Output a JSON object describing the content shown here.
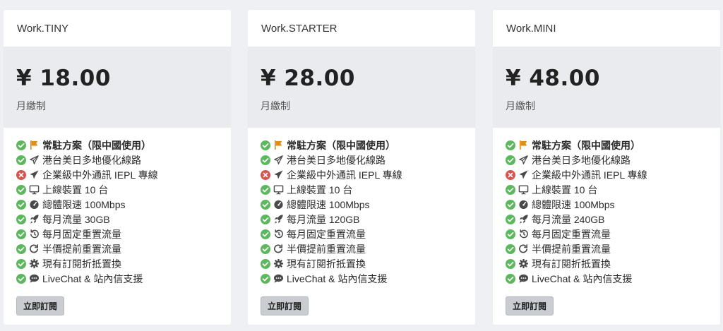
{
  "colors": {
    "check": "#5cb85c",
    "cross": "#d9534f",
    "highlight": "#e48c15",
    "icon": "#4a4a4a"
  },
  "plans": [
    {
      "name": "Work.TINY",
      "price": "¥ 18.00",
      "period": "月繳制",
      "features": [
        {
          "status": "check",
          "icon": "flag-icon",
          "text": "常駐方案（限中國使用）",
          "highlight": true
        },
        {
          "status": "check",
          "icon": "paper-plane-outline-icon",
          "text": "港台美日多地優化線路"
        },
        {
          "status": "cross",
          "icon": "paper-plane-icon",
          "text": "企業級中外通訊 IEPL 專線"
        },
        {
          "status": "check",
          "icon": "monitor-icon",
          "text": "上線裝置 10 台"
        },
        {
          "status": "check",
          "icon": "speedometer-icon",
          "text": "總體限速 100Mbps"
        },
        {
          "status": "check",
          "icon": "rocket-icon",
          "text": "每月流量 30GB"
        },
        {
          "status": "check",
          "icon": "history-icon",
          "text": "每月固定重置流量"
        },
        {
          "status": "check",
          "icon": "redo-icon",
          "text": "半價提前重置流量"
        },
        {
          "status": "check",
          "icon": "gear-icon",
          "text": "現有訂閱折抵置換"
        },
        {
          "status": "check",
          "icon": "chat-bubble-icon",
          "text": "LiveChat & 站內信支援"
        }
      ],
      "button": "立即訂閱"
    },
    {
      "name": "Work.STARTER",
      "price": "¥ 28.00",
      "period": "月繳制",
      "features": [
        {
          "status": "check",
          "icon": "flag-icon",
          "text": "常駐方案（限中國使用）",
          "highlight": true
        },
        {
          "status": "check",
          "icon": "paper-plane-outline-icon",
          "text": "港台美日多地優化線路"
        },
        {
          "status": "cross",
          "icon": "paper-plane-icon",
          "text": "企業級中外通訊 IEPL 專線"
        },
        {
          "status": "check",
          "icon": "monitor-icon",
          "text": "上線裝置 10 台"
        },
        {
          "status": "check",
          "icon": "speedometer-icon",
          "text": "總體限速 100Mbps"
        },
        {
          "status": "check",
          "icon": "rocket-icon",
          "text": "每月流量 120GB"
        },
        {
          "status": "check",
          "icon": "history-icon",
          "text": "每月固定重置流量"
        },
        {
          "status": "check",
          "icon": "redo-icon",
          "text": "半價提前重置流量"
        },
        {
          "status": "check",
          "icon": "gear-icon",
          "text": "現有訂閱折抵置換"
        },
        {
          "status": "check",
          "icon": "chat-bubble-icon",
          "text": "LiveChat & 站內信支援"
        }
      ],
      "button": "立即訂閱"
    },
    {
      "name": "Work.MINI",
      "price": "¥ 48.00",
      "period": "月繳制",
      "features": [
        {
          "status": "check",
          "icon": "flag-icon",
          "text": "常駐方案（限中國使用）",
          "highlight": true
        },
        {
          "status": "check",
          "icon": "paper-plane-outline-icon",
          "text": "港台美日多地優化線路"
        },
        {
          "status": "cross",
          "icon": "paper-plane-icon",
          "text": "企業級中外通訊 IEPL 專線"
        },
        {
          "status": "check",
          "icon": "monitor-icon",
          "text": "上線裝置 10 台"
        },
        {
          "status": "check",
          "icon": "speedometer-icon",
          "text": "總體限速 100Mbps"
        },
        {
          "status": "check",
          "icon": "rocket-icon",
          "text": "每月流量 240GB"
        },
        {
          "status": "check",
          "icon": "history-icon",
          "text": "每月固定重置流量"
        },
        {
          "status": "check",
          "icon": "redo-icon",
          "text": "半價提前重置流量"
        },
        {
          "status": "check",
          "icon": "gear-icon",
          "text": "現有訂閱折抵置換"
        },
        {
          "status": "check",
          "icon": "chat-bubble-icon",
          "text": "LiveChat & 站內信支援"
        }
      ],
      "button": "立即訂閱"
    }
  ]
}
